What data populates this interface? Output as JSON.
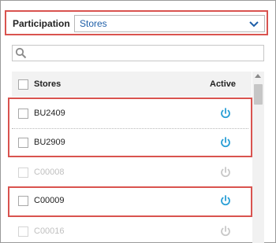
{
  "participation": {
    "label": "Participation",
    "selected": "Stores"
  },
  "search": {
    "placeholder": ""
  },
  "list": {
    "header": {
      "stores_label": "Stores",
      "active_label": "Active"
    },
    "rows": [
      {
        "code": "BU2409",
        "active": true
      },
      {
        "code": "BU2909",
        "active": true
      },
      {
        "code": "C00008",
        "active": false
      },
      {
        "code": "C00009",
        "active": true
      },
      {
        "code": "C00016",
        "active": false
      }
    ]
  },
  "colors": {
    "highlight": "#d9534f",
    "power_active": "#2a9fd6",
    "power_inactive": "#c8c8c8",
    "select_text": "#1f5fa8"
  }
}
